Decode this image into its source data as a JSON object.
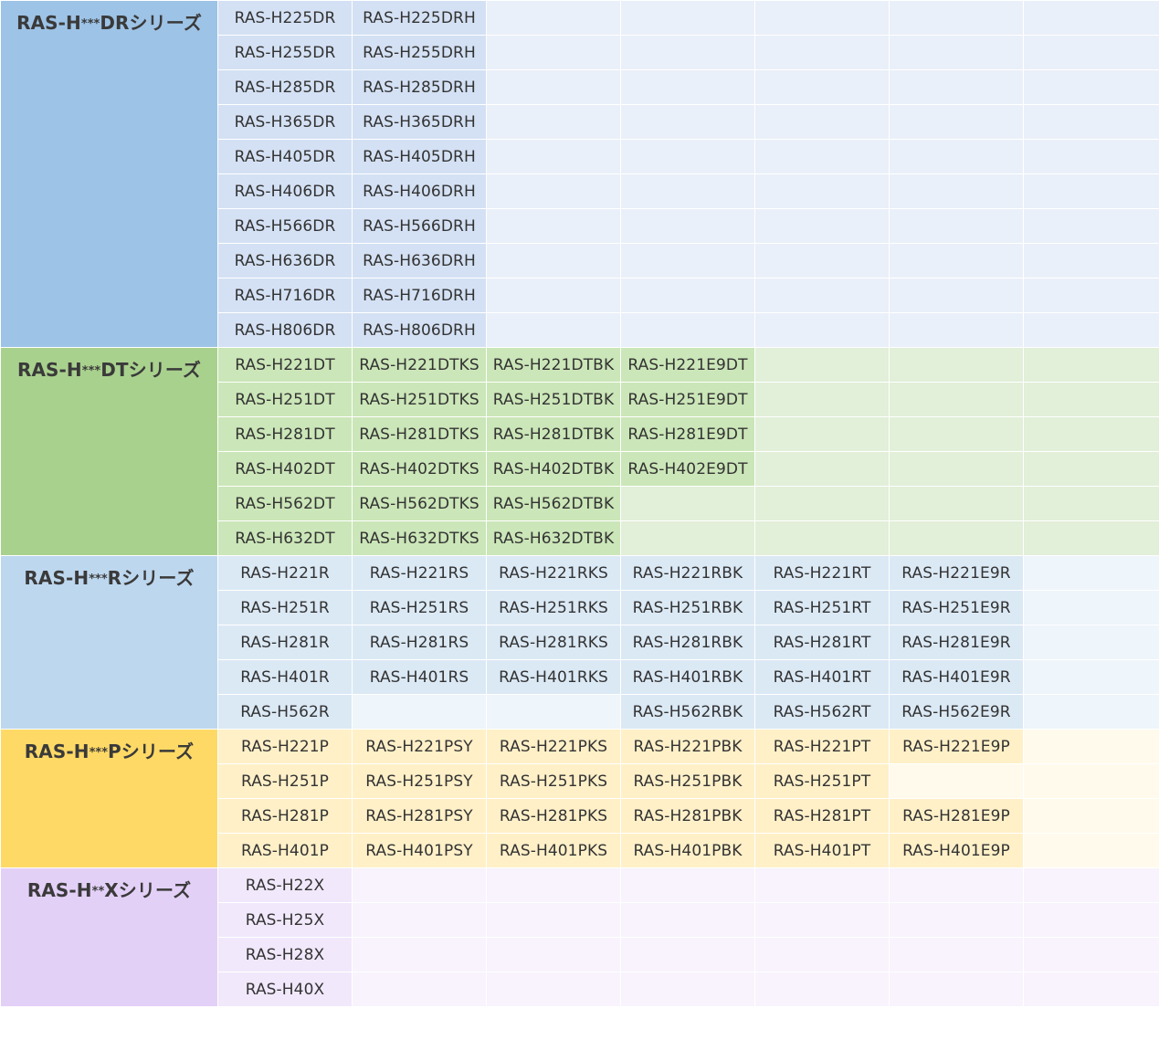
{
  "series": [
    {
      "key": "dr",
      "title_prefix": "RAS-H",
      "title_stars": "***",
      "title_suffix": "DRシリーズ",
      "rows": [
        [
          "RAS-H225DR",
          "RAS-H225DRH",
          "",
          "",
          "",
          "",
          ""
        ],
        [
          "RAS-H255DR",
          "RAS-H255DRH",
          "",
          "",
          "",
          "",
          ""
        ],
        [
          "RAS-H285DR",
          "RAS-H285DRH",
          "",
          "",
          "",
          "",
          ""
        ],
        [
          "RAS-H365DR",
          "RAS-H365DRH",
          "",
          "",
          "",
          "",
          ""
        ],
        [
          "RAS-H405DR",
          "RAS-H405DRH",
          "",
          "",
          "",
          "",
          ""
        ],
        [
          "RAS-H406DR",
          "RAS-H406DRH",
          "",
          "",
          "",
          "",
          ""
        ],
        [
          "RAS-H566DR",
          "RAS-H566DRH",
          "",
          "",
          "",
          "",
          ""
        ],
        [
          "RAS-H636DR",
          "RAS-H636DRH",
          "",
          "",
          "",
          "",
          ""
        ],
        [
          "RAS-H716DR",
          "RAS-H716DRH",
          "",
          "",
          "",
          "",
          ""
        ],
        [
          "RAS-H806DR",
          "RAS-H806DRH",
          "",
          "",
          "",
          "",
          ""
        ]
      ]
    },
    {
      "key": "dt",
      "title_prefix": "RAS-H",
      "title_stars": "***",
      "title_suffix": "DTシリーズ",
      "rows": [
        [
          "RAS-H221DT",
          "RAS-H221DTKS",
          "RAS-H221DTBK",
          "RAS-H221E9DT",
          "",
          "",
          ""
        ],
        [
          "RAS-H251DT",
          "RAS-H251DTKS",
          "RAS-H251DTBK",
          "RAS-H251E9DT",
          "",
          "",
          ""
        ],
        [
          "RAS-H281DT",
          "RAS-H281DTKS",
          "RAS-H281DTBK",
          "RAS-H281E9DT",
          "",
          "",
          ""
        ],
        [
          "RAS-H402DT",
          "RAS-H402DTKS",
          "RAS-H402DTBK",
          "RAS-H402E9DT",
          "",
          "",
          ""
        ],
        [
          "RAS-H562DT",
          "RAS-H562DTKS",
          "RAS-H562DTBK",
          "",
          "",
          "",
          ""
        ],
        [
          "RAS-H632DT",
          "RAS-H632DTKS",
          "RAS-H632DTBK",
          "",
          "",
          "",
          ""
        ]
      ]
    },
    {
      "key": "r",
      "title_prefix": "RAS-H",
      "title_stars": "***",
      "title_suffix": "Rシリーズ",
      "rows": [
        [
          "RAS-H221R",
          "RAS-H221RS",
          "RAS-H221RKS",
          "RAS-H221RBK",
          "RAS-H221RT",
          "RAS-H221E9R",
          ""
        ],
        [
          "RAS-H251R",
          "RAS-H251RS",
          "RAS-H251RKS",
          "RAS-H251RBK",
          "RAS-H251RT",
          "RAS-H251E9R",
          ""
        ],
        [
          "RAS-H281R",
          "RAS-H281RS",
          "RAS-H281RKS",
          "RAS-H281RBK",
          "RAS-H281RT",
          "RAS-H281E9R",
          ""
        ],
        [
          "RAS-H401R",
          "RAS-H401RS",
          "RAS-H401RKS",
          "RAS-H401RBK",
          "RAS-H401RT",
          "RAS-H401E9R",
          ""
        ],
        [
          "RAS-H562R",
          "",
          "",
          "RAS-H562RBK",
          "RAS-H562RT",
          "RAS-H562E9R",
          ""
        ]
      ]
    },
    {
      "key": "p",
      "title_prefix": "RAS-H",
      "title_stars": "***",
      "title_suffix": "Pシリーズ",
      "rows": [
        [
          "RAS-H221P",
          "RAS-H221PSY",
          "RAS-H221PKS",
          "RAS-H221PBK",
          "RAS-H221PT",
          "RAS-H221E9P",
          ""
        ],
        [
          "RAS-H251P",
          "RAS-H251PSY",
          "RAS-H251PKS",
          "RAS-H251PBK",
          "RAS-H251PT",
          "",
          ""
        ],
        [
          "RAS-H281P",
          "RAS-H281PSY",
          "RAS-H281PKS",
          "RAS-H281PBK",
          "RAS-H281PT",
          "RAS-H281E9P",
          ""
        ],
        [
          "RAS-H401P",
          "RAS-H401PSY",
          "RAS-H401PKS",
          "RAS-H401PBK",
          "RAS-H401PT",
          "RAS-H401E9P",
          ""
        ]
      ]
    },
    {
      "key": "x",
      "title_prefix": "RAS-H",
      "title_stars": "**",
      "title_suffix": "Xシリーズ",
      "rows": [
        [
          "RAS-H22X",
          "",
          "",
          "",
          "",
          "",
          ""
        ],
        [
          "RAS-H25X",
          "",
          "",
          "",
          "",
          "",
          ""
        ],
        [
          "RAS-H28X",
          "",
          "",
          "",
          "",
          "",
          ""
        ],
        [
          "RAS-H40X",
          "",
          "",
          "",
          "",
          "",
          ""
        ]
      ]
    }
  ]
}
